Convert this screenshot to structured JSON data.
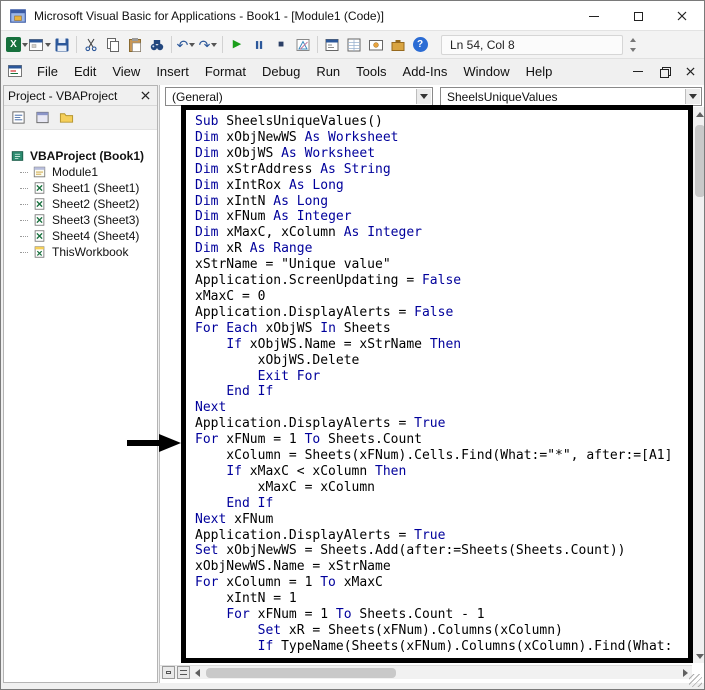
{
  "window": {
    "title": "Microsoft Visual Basic for Applications - Book1 - [Module1 (Code)]"
  },
  "toolbar": {
    "position_indicator": "Ln 54, Col 8",
    "icons": [
      "view-microsoft-excel",
      "insert-userform",
      "save",
      "cut",
      "copy",
      "paste",
      "find",
      "undo",
      "redo",
      "run-sub",
      "break",
      "reset",
      "design-mode",
      "project-explorer",
      "properties-window",
      "object-browser",
      "toolbox",
      "help"
    ]
  },
  "icons": {
    "excel_glyph": "X",
    "undo_glyph": "↶",
    "redo_glyph": "↷",
    "run_glyph": "▶",
    "reset_glyph": "■",
    "help_glyph": "?"
  },
  "menu": {
    "items": [
      "File",
      "Edit",
      "View",
      "Insert",
      "Format",
      "Debug",
      "Run",
      "Tools",
      "Add-Ins",
      "Window",
      "Help"
    ]
  },
  "project_panel": {
    "title": "Project - VBAProject",
    "tree": [
      {
        "label": "VBAProject (Book1)",
        "icon": "project-icon"
      },
      {
        "label": "Module1",
        "icon": "module-icon"
      },
      {
        "label": "Sheet1 (Sheet1)",
        "icon": "worksheet-icon"
      },
      {
        "label": "Sheet2 (Sheet2)",
        "icon": "worksheet-icon"
      },
      {
        "label": "Sheet3 (Sheet3)",
        "icon": "worksheet-icon"
      },
      {
        "label": "Sheet4 (Sheet4)",
        "icon": "worksheet-icon"
      },
      {
        "label": "ThisWorkbook",
        "icon": "workbook-icon"
      }
    ]
  },
  "code_panel": {
    "object_dropdown": "(General)",
    "procedure_dropdown": "SheelsUniqueValues",
    "colors": {
      "keyword": "#00009B",
      "text": "#000000"
    },
    "annotations": {
      "arrow_points_to": "For xFNum = 1 To Sheets.Count"
    },
    "code_lines": [
      [
        [
          "k",
          "Sub"
        ],
        [
          "t",
          " SheelsUniqueValues()"
        ]
      ],
      [
        [
          "k",
          "Dim"
        ],
        [
          "t",
          " xObjNewWS "
        ],
        [
          "k",
          "As Worksheet"
        ]
      ],
      [
        [
          "k",
          "Dim"
        ],
        [
          "t",
          " xObjWS "
        ],
        [
          "k",
          "As Worksheet"
        ]
      ],
      [
        [
          "k",
          "Dim"
        ],
        [
          "t",
          " xStrAddress "
        ],
        [
          "k",
          "As String"
        ]
      ],
      [
        [
          "k",
          "Dim"
        ],
        [
          "t",
          " xIntRox "
        ],
        [
          "k",
          "As Long"
        ]
      ],
      [
        [
          "k",
          "Dim"
        ],
        [
          "t",
          " xIntN "
        ],
        [
          "k",
          "As Long"
        ]
      ],
      [
        [
          "k",
          "Dim"
        ],
        [
          "t",
          " xFNum "
        ],
        [
          "k",
          "As Integer"
        ]
      ],
      [
        [
          "k",
          "Dim"
        ],
        [
          "t",
          " xMaxC, xColumn "
        ],
        [
          "k",
          "As Integer"
        ]
      ],
      [
        [
          "k",
          "Dim"
        ],
        [
          "t",
          " xR "
        ],
        [
          "k",
          "As Range"
        ]
      ],
      [
        [
          "t",
          "xStrName = \"Unique value\""
        ]
      ],
      [
        [
          "t",
          "Application.ScreenUpdating = "
        ],
        [
          "k",
          "False"
        ]
      ],
      [
        [
          "t",
          "xMaxC = 0"
        ]
      ],
      [
        [
          "t",
          "Application.DisplayAlerts = "
        ],
        [
          "k",
          "False"
        ]
      ],
      [
        [
          "k",
          "For Each"
        ],
        [
          "t",
          " xObjWS "
        ],
        [
          "k",
          "In"
        ],
        [
          "t",
          " Sheets"
        ]
      ],
      [
        [
          "t",
          "    "
        ],
        [
          "k",
          "If"
        ],
        [
          "t",
          " xObjWS.Name = xStrName "
        ],
        [
          "k",
          "Then"
        ]
      ],
      [
        [
          "t",
          "        xObjWS.Delete"
        ]
      ],
      [
        [
          "t",
          "        "
        ],
        [
          "k",
          "Exit For"
        ]
      ],
      [
        [
          "t",
          "    "
        ],
        [
          "k",
          "End If"
        ]
      ],
      [
        [
          "k",
          "Next"
        ]
      ],
      [
        [
          "t",
          "Application.DisplayAlerts = "
        ],
        [
          "k",
          "True"
        ]
      ],
      [
        [
          "k",
          "For"
        ],
        [
          "t",
          " xFNum = 1 "
        ],
        [
          "k",
          "To"
        ],
        [
          "t",
          " Sheets.Count"
        ]
      ],
      [
        [
          "t",
          "    xColumn = Sheets(xFNum).Cells.Find(What:=\"*\", after:=[A1]"
        ]
      ],
      [
        [
          "t",
          "    "
        ],
        [
          "k",
          "If"
        ],
        [
          "t",
          " xMaxC < xColumn "
        ],
        [
          "k",
          "Then"
        ]
      ],
      [
        [
          "t",
          "        xMaxC = xColumn"
        ]
      ],
      [
        [
          "t",
          "    "
        ],
        [
          "k",
          "End If"
        ]
      ],
      [
        [
          "k",
          "Next"
        ],
        [
          "t",
          " xFNum"
        ]
      ],
      [
        [
          "t",
          "Application.DisplayAlerts = "
        ],
        [
          "k",
          "True"
        ]
      ],
      [
        [
          "k",
          "Set"
        ],
        [
          "t",
          " xObjNewWS = Sheets.Add(after:=Sheets(Sheets.Count))"
        ]
      ],
      [
        [
          "t",
          "xObjNewWS.Name = xStrName"
        ]
      ],
      [
        [
          "k",
          "For"
        ],
        [
          "t",
          " xColumn = 1 "
        ],
        [
          "k",
          "To"
        ],
        [
          "t",
          " xMaxC"
        ]
      ],
      [
        [
          "t",
          "    xIntN = 1"
        ]
      ],
      [
        [
          "t",
          "    "
        ],
        [
          "k",
          "For"
        ],
        [
          "t",
          " xFNum = 1 "
        ],
        [
          "k",
          "To"
        ],
        [
          "t",
          " Sheets.Count - 1"
        ]
      ],
      [
        [
          "t",
          "        "
        ],
        [
          "k",
          "Set"
        ],
        [
          "t",
          " xR = Sheets(xFNum).Columns(xColumn)"
        ]
      ],
      [
        [
          "t",
          "        "
        ],
        [
          "k",
          "If"
        ],
        [
          "t",
          " TypeName(Sheets(xFNum).Columns(xColumn).Find(What:"
        ]
      ]
    ]
  }
}
